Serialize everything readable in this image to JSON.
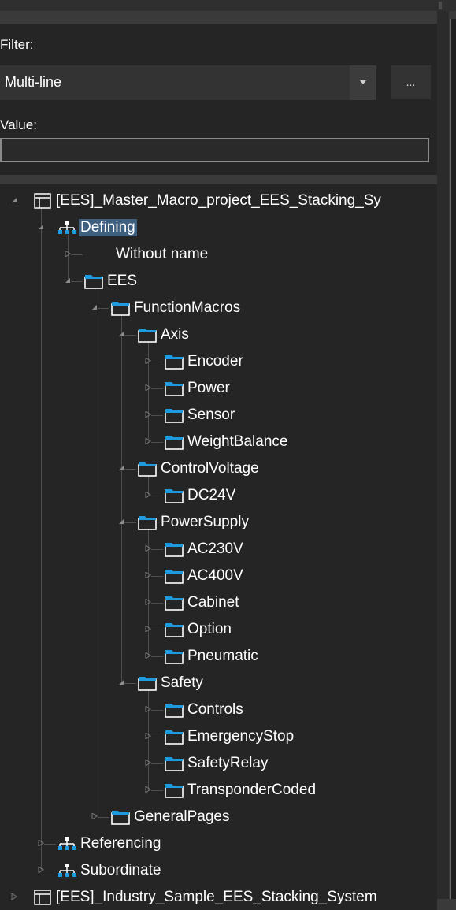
{
  "filter": {
    "label": "Filter:",
    "selected": "Multi-line",
    "more_label": "..."
  },
  "value": {
    "label": "Value:",
    "text": ""
  },
  "tree": [
    {
      "label": "[EES]_Master_Macro_project_EES_Stacking_Sy",
      "icon": "project-icon",
      "level": 0,
      "state": "expanded"
    },
    {
      "label": "Defining",
      "icon": "hierarchy-icon",
      "level": 1,
      "state": "expanded",
      "selected": true
    },
    {
      "label": "Without name",
      "icon": "",
      "level": 2,
      "state": "collapsed"
    },
    {
      "label": "EES",
      "icon": "folder-icon",
      "level": 2,
      "state": "expanded"
    },
    {
      "label": "FunctionMacros",
      "icon": "folder-icon",
      "level": 3,
      "state": "expanded"
    },
    {
      "label": "Axis",
      "icon": "folder-icon",
      "level": 4,
      "state": "expanded"
    },
    {
      "label": "Encoder",
      "icon": "folder-icon",
      "level": 5,
      "state": "collapsed"
    },
    {
      "label": "Power",
      "icon": "folder-icon",
      "level": 5,
      "state": "collapsed"
    },
    {
      "label": "Sensor",
      "icon": "folder-icon",
      "level": 5,
      "state": "collapsed"
    },
    {
      "label": "WeightBalance",
      "icon": "folder-icon",
      "level": 5,
      "state": "collapsed"
    },
    {
      "label": "ControlVoltage",
      "icon": "folder-icon",
      "level": 4,
      "state": "expanded"
    },
    {
      "label": "DC24V",
      "icon": "folder-icon",
      "level": 5,
      "state": "collapsed"
    },
    {
      "label": "PowerSupply",
      "icon": "folder-icon",
      "level": 4,
      "state": "expanded"
    },
    {
      "label": "AC230V",
      "icon": "folder-icon",
      "level": 5,
      "state": "collapsed"
    },
    {
      "label": "AC400V",
      "icon": "folder-icon",
      "level": 5,
      "state": "collapsed"
    },
    {
      "label": "Cabinet",
      "icon": "folder-icon",
      "level": 5,
      "state": "collapsed"
    },
    {
      "label": "Option",
      "icon": "folder-icon",
      "level": 5,
      "state": "collapsed"
    },
    {
      "label": "Pneumatic",
      "icon": "folder-icon",
      "level": 5,
      "state": "collapsed"
    },
    {
      "label": "Safety",
      "icon": "folder-icon",
      "level": 4,
      "state": "expanded"
    },
    {
      "label": "Controls",
      "icon": "folder-icon",
      "level": 5,
      "state": "collapsed"
    },
    {
      "label": "EmergencyStop",
      "icon": "folder-icon",
      "level": 5,
      "state": "collapsed"
    },
    {
      "label": "SafetyRelay",
      "icon": "folder-icon",
      "level": 5,
      "state": "collapsed"
    },
    {
      "label": "TransponderCoded",
      "icon": "folder-icon",
      "level": 5,
      "state": "collapsed"
    },
    {
      "label": "GeneralPages",
      "icon": "folder-icon",
      "level": 3,
      "state": "collapsed"
    },
    {
      "label": "Referencing",
      "icon": "hierarchy-icon",
      "level": 1,
      "state": "collapsed"
    },
    {
      "label": "Subordinate",
      "icon": "hierarchy-icon",
      "level": 1,
      "state": "collapsed"
    },
    {
      "label": "[EES]_Industry_Sample_EES_Stacking_System",
      "icon": "project-icon",
      "level": 0,
      "state": "collapsed"
    }
  ],
  "colors": {
    "panel_bg": "#252526",
    "folder_blue": "#1e9bde",
    "selection": "#3f5f7f"
  }
}
